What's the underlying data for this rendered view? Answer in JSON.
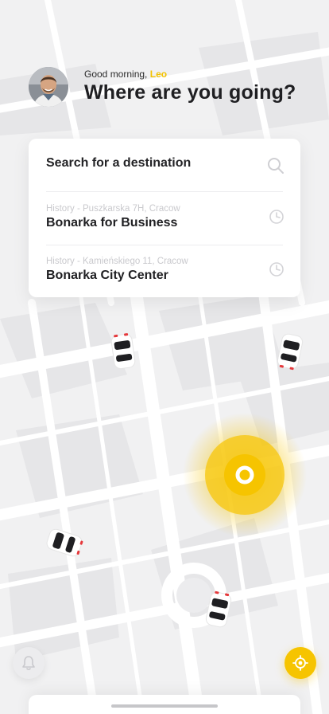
{
  "header": {
    "greeting": "Good morning,",
    "user_name": "Leo",
    "title": "Where are you going?"
  },
  "search": {
    "placeholder": "Search for a destination",
    "icon": "search-icon"
  },
  "history": [
    {
      "subtitle": "History - Puszkarska 7H, Cracow",
      "title": "Bonarka for Business",
      "icon": "clock-icon"
    },
    {
      "subtitle": "History - Kamieńskiego 11, Cracow",
      "title": "Bonarka City Center",
      "icon": "clock-icon"
    }
  ],
  "map": {
    "location_marker_icon": "current-location-pin-icon",
    "car_icon": "car-icon"
  },
  "buttons": {
    "notifications_icon": "bell-icon",
    "locate_icon": "locate-me-icon"
  },
  "colors": {
    "accent": "#f6c400",
    "title": "#1f1f22",
    "muted": "#c9c9cd",
    "map_background": "#f1f1f2"
  }
}
